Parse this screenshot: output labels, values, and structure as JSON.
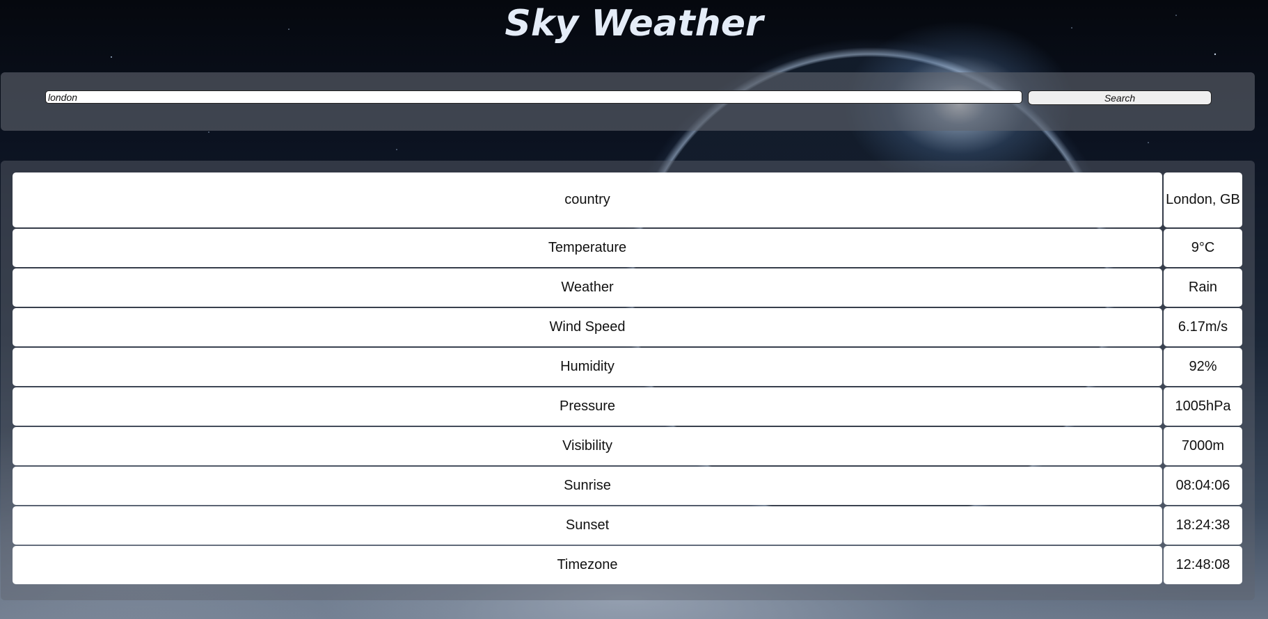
{
  "app": {
    "title": "Sky Weather"
  },
  "search": {
    "value": "london",
    "button_label": "Search"
  },
  "results": {
    "rows": [
      {
        "label": "country",
        "value": "London, GB"
      },
      {
        "label": "Temperature",
        "value": "9°C"
      },
      {
        "label": "Weather",
        "value": "Rain"
      },
      {
        "label": "Wind Speed",
        "value": "6.17m/s"
      },
      {
        "label": "Humidity",
        "value": "92%"
      },
      {
        "label": "Pressure",
        "value": "1005hPa"
      },
      {
        "label": "Visibility",
        "value": "7000m"
      },
      {
        "label": "Sunrise",
        "value": "08:04:06"
      },
      {
        "label": "Sunset",
        "value": "18:24:38"
      },
      {
        "label": "Timezone",
        "value": "12:48:08"
      }
    ]
  },
  "colors": {
    "title": "#e4ecf7",
    "panel": "#5f646e",
    "cell_background": "#ffffff"
  }
}
